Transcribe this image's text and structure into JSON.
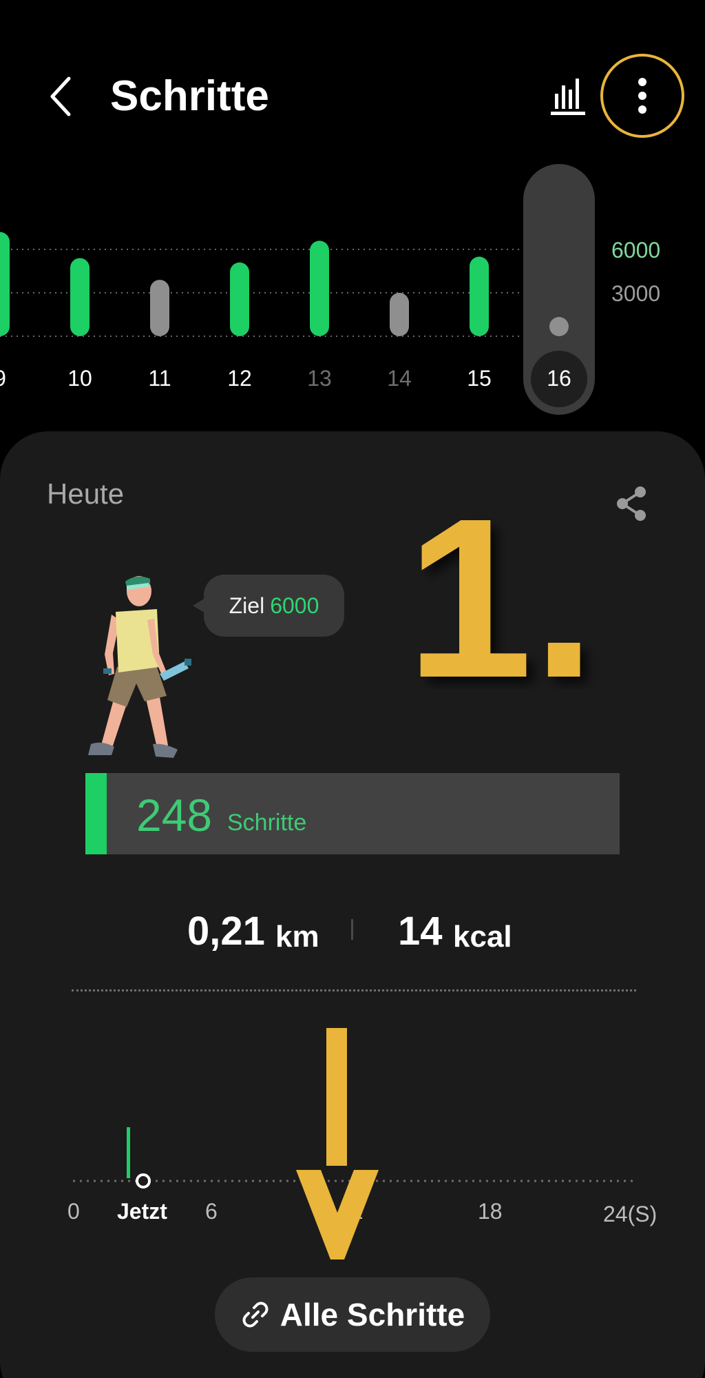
{
  "header": {
    "title": "Schritte",
    "back_icon": "chevron-left-icon",
    "trend_icon": "bar-chart-icon",
    "more_icon": "more-vertical-icon",
    "highlight_color": "#e9b53a"
  },
  "weekly_chart": {
    "days": [
      {
        "label": "9",
        "steps": 7200,
        "color": "#1dcf64"
      },
      {
        "label": "10",
        "steps": 5400,
        "color": "#1dcf64"
      },
      {
        "label": "11",
        "steps": 3900,
        "color": "#8f8f8f"
      },
      {
        "label": "12",
        "steps": 5100,
        "color": "#1dcf64"
      },
      {
        "label": "13",
        "steps": 6600,
        "color": "#1dcf64"
      },
      {
        "label": "14",
        "steps": 3000,
        "color": "#8f8f8f"
      },
      {
        "label": "15",
        "steps": 5500,
        "color": "#1dcf64"
      },
      {
        "label": "16",
        "steps": 248,
        "color": "#8f8f8f"
      }
    ],
    "selected_day": "16",
    "dimmed_days": [
      "13",
      "14"
    ],
    "gridlines": [
      6000,
      3000,
      0
    ],
    "y_labels": [
      {
        "value": "6000",
        "color": "#7fd99b"
      },
      {
        "value": "3000",
        "color": "#9d9d9d"
      }
    ]
  },
  "today": {
    "label": "Heute",
    "share_icon": "share-icon",
    "goal_label": "Ziel",
    "goal_value": "6000",
    "annotation": "1.",
    "steps": "248",
    "steps_unit": "Schritte",
    "progress_fraction": 0.04,
    "distance_value": "0,21",
    "distance_unit": "km",
    "calories_value": "14",
    "calories_unit": "kcal"
  },
  "timeline": {
    "labels": [
      "0",
      "Jetzt",
      "6",
      "12",
      "18",
      "24(S)"
    ],
    "now_hour": 3
  },
  "footer": {
    "all_steps_label": "Alle Schritte",
    "link_icon": "link-icon"
  }
}
